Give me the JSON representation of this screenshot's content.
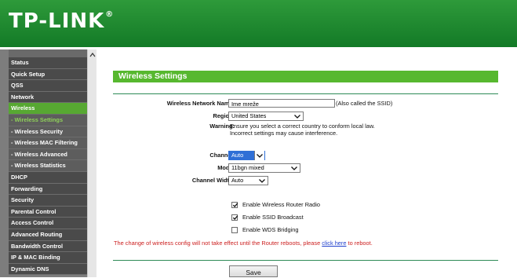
{
  "brand": {
    "logo_text": "TP-LINK",
    "registered_mark": "®"
  },
  "colors": {
    "header": "#1f8a30",
    "accent": "#57b82f",
    "sidebar": "#4a4a4a",
    "warning": "#cc1f1f",
    "link": "#1f3fcc"
  },
  "sidebar": {
    "items": [
      {
        "label": "Status"
      },
      {
        "label": "Quick Setup"
      },
      {
        "label": "QSS"
      },
      {
        "label": "Network"
      },
      {
        "label": "Wireless"
      },
      {
        "label": "- Wireless Settings"
      },
      {
        "label": "- Wireless Security"
      },
      {
        "label": "- Wireless MAC Filtering"
      },
      {
        "label": "- Wireless Advanced"
      },
      {
        "label": "- Wireless Statistics"
      },
      {
        "label": "DHCP"
      },
      {
        "label": "Forwarding"
      },
      {
        "label": "Security"
      },
      {
        "label": "Parental Control"
      },
      {
        "label": "Access Control"
      },
      {
        "label": "Advanced Routing"
      },
      {
        "label": "Bandwidth Control"
      },
      {
        "label": "IP & MAC Binding"
      },
      {
        "label": "Dynamic DNS"
      }
    ]
  },
  "main": {
    "title": "Wireless Settings",
    "ssid": {
      "label": "Wireless Network Name:",
      "value": "Ime mreže",
      "hint": "(Also called the SSID)"
    },
    "region": {
      "label": "Region:",
      "value": "United States"
    },
    "warning": {
      "label": "Warning:",
      "line1": "Ensure you select a correct country to conform local law.",
      "line2": "Incorrect settings may cause interference."
    },
    "channel": {
      "label": "Channel:",
      "value": "Auto"
    },
    "mode": {
      "label": "Mode:",
      "value": "11bgn mixed"
    },
    "channel_width": {
      "label": "Channel Width:",
      "value": "Auto"
    },
    "checkboxes": [
      {
        "label": "Enable Wireless Router Radio",
        "checked": true
      },
      {
        "label": "Enable SSID Broadcast",
        "checked": true
      },
      {
        "label": "Enable WDS Bridging",
        "checked": false
      }
    ],
    "notice": {
      "before": "The change of wireless config will not take effect until the Router reboots, please ",
      "link": "click here",
      "after": " to reboot."
    },
    "save_label": "Save"
  }
}
